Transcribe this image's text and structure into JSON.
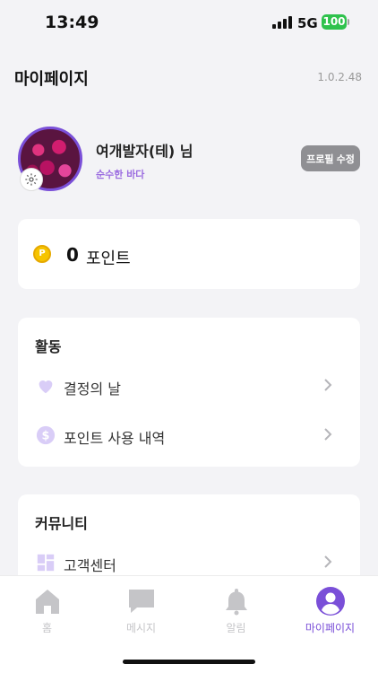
{
  "status_bar": {
    "time": "13:49",
    "network": "5G",
    "battery": "100"
  },
  "header": {
    "title": "마이페이지",
    "version": "1.0.2.48"
  },
  "profile": {
    "nickname": "여개발자(테) 님",
    "subtitle": "순수한 바다",
    "edit_button": "프로필 수정"
  },
  "points": {
    "value": "0",
    "unit": "포인트",
    "coin_symbol": "P"
  },
  "activity": {
    "title": "활동",
    "items": [
      {
        "label": "결정의 날",
        "icon": "heart-icon"
      },
      {
        "label": "포인트 사용 내역",
        "icon": "dollar-icon"
      }
    ]
  },
  "community": {
    "title": "커뮤니티",
    "items": [
      {
        "label": "고객센터",
        "icon": "grid-icon"
      }
    ]
  },
  "tab_bar": {
    "tabs": [
      {
        "label": "홈",
        "icon": "home-icon"
      },
      {
        "label": "메시지",
        "icon": "message-icon"
      },
      {
        "label": "알림",
        "icon": "bell-icon"
      },
      {
        "label": "마이페이지",
        "icon": "profile-icon",
        "active": true
      }
    ]
  },
  "colors": {
    "accent": "#7a4fd8",
    "battery": "#2fc24d",
    "inactive": "#c5c5c8"
  }
}
